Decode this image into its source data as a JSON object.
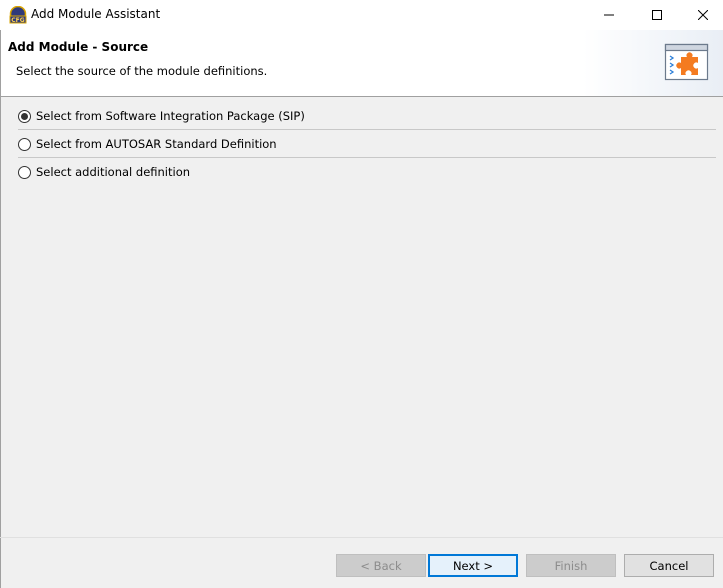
{
  "window": {
    "title": "Add Module Assistant",
    "icon_text": "CFG"
  },
  "header": {
    "title": "Add Module - Source",
    "description": "Select the source of the module definitions."
  },
  "options": [
    {
      "label": "Select from Software Integration Package (SIP)",
      "checked": true
    },
    {
      "label": "Select from AUTOSAR Standard Definition",
      "checked": false
    },
    {
      "label": "Select additional definition",
      "checked": false
    }
  ],
  "buttons": {
    "back": "< Back",
    "next": "Next >",
    "finish": "Finish",
    "cancel": "Cancel"
  },
  "colors": {
    "accent": "#0078d7",
    "puzzle": "#f47b20",
    "background": "#f0f0f0"
  }
}
